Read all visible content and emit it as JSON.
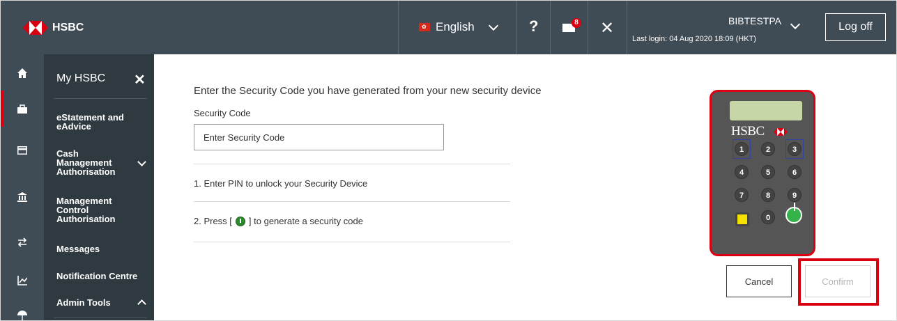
{
  "header": {
    "brand": "HSBC",
    "language": "English",
    "help_label": "?",
    "messages_badge": "8",
    "tools_label": "✕",
    "user_name": "BIBTESTPA",
    "last_login": "Last login: 04 Aug 2020 18:09 (HKT)",
    "logoff_label": "Log off"
  },
  "rail": {
    "icons": [
      "home-icon",
      "briefcase-icon",
      "card-icon",
      "bank-icon",
      "transfer-icon",
      "chart-icon",
      "umbrella-icon"
    ]
  },
  "menu": {
    "title": "My HSBC",
    "close_label": "✕",
    "items": [
      {
        "label": "eStatement and eAdvice"
      },
      {
        "label": "Cash Management Authorisation"
      },
      {
        "label": "Management Control Authorisation"
      },
      {
        "label": "Messages"
      },
      {
        "label": "Notification Centre"
      },
      {
        "label": "Admin Tools"
      }
    ]
  },
  "main": {
    "instruction": "Enter the Security Code you have generated from your new security device",
    "code_label": "Security Code",
    "code_placeholder": "Enter Security Code",
    "step1": "1. Enter PIN to unlock your Security Device",
    "step2_prefix": "2. Press [",
    "step2_suffix": "] to generate a security code",
    "cancel_label": "Cancel",
    "confirm_label": "Confirm"
  },
  "device": {
    "brand": "HSBC",
    "keys": [
      "1",
      "2",
      "3",
      "4",
      "5",
      "6",
      "7",
      "8",
      "9",
      "0"
    ]
  },
  "colors": {
    "topbar": "#3f4b55",
    "menu": "#2f3940",
    "accent_red": "#db0011"
  }
}
